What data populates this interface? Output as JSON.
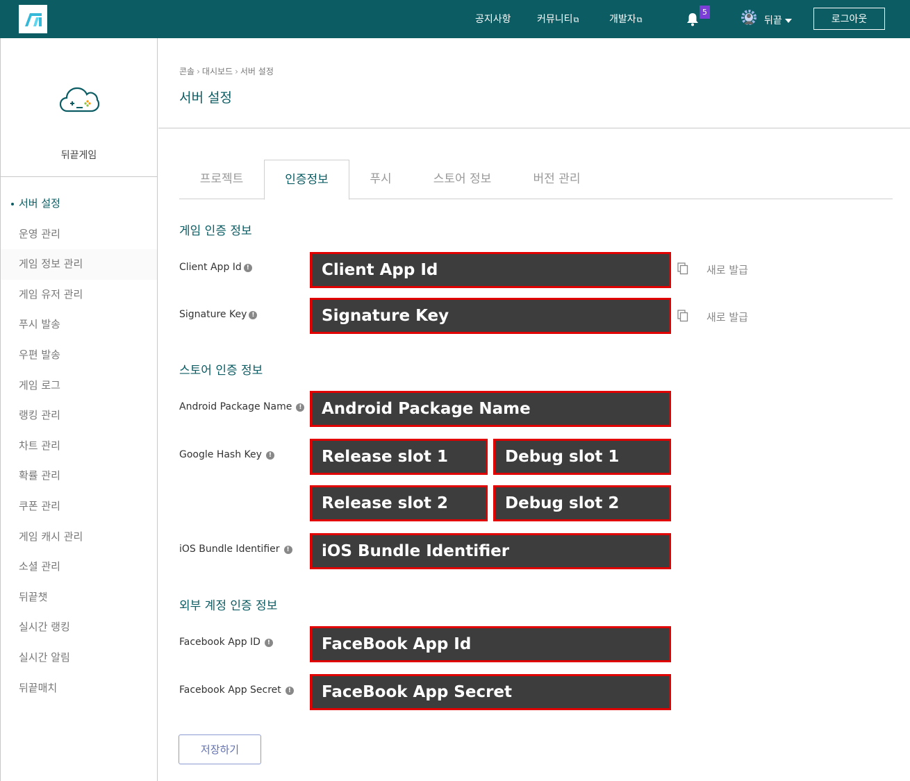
{
  "header": {
    "nav": [
      "공지사항",
      "커뮤니티",
      "개발자"
    ],
    "external_icon": "external-link-icon",
    "notification_count": "5",
    "user_name": "뒤끝",
    "logout_label": "로그아웃",
    "colors": {
      "header_bg": "#0b5c63",
      "badge_bg": "#7b3ed7"
    }
  },
  "sidebar": {
    "game_name": "뒤끝게임",
    "items": [
      {
        "label": "서버 설정",
        "active": true
      },
      {
        "label": "운영 관리"
      },
      {
        "label": "게임 정보 관리"
      },
      {
        "label": "게임 유저 관리"
      },
      {
        "label": "푸시 발송"
      },
      {
        "label": "우편 발송"
      },
      {
        "label": "게임 로그"
      },
      {
        "label": "랭킹 관리"
      },
      {
        "label": "차트 관리"
      },
      {
        "label": "확률 관리"
      },
      {
        "label": "쿠폰 관리"
      },
      {
        "label": "게임 캐시 관리"
      },
      {
        "label": "소셜 관리"
      },
      {
        "label": "뒤끝챗"
      },
      {
        "label": "실시간 랭킹"
      },
      {
        "label": "실시간 알림"
      },
      {
        "label": "뒤끝매치"
      }
    ]
  },
  "breadcrumb": [
    "콘솔",
    "대시보드",
    "서버 설정"
  ],
  "page_title": "서버 설정",
  "tabs": [
    {
      "label": "프로젝트"
    },
    {
      "label": "인증정보",
      "active": true
    },
    {
      "label": "푸시"
    },
    {
      "label": "스토어 정보"
    },
    {
      "label": "버전 관리"
    }
  ],
  "sections": {
    "game_auth": "게임 인증 정보",
    "store_auth": "스토어 인증 정보",
    "external_auth": "외부 계정 인증 정보"
  },
  "fields": {
    "client_app_id": {
      "label": "Client App Id",
      "value": "Client App Id"
    },
    "signature_key": {
      "label": "Signature Key",
      "value": "Signature Key"
    },
    "android_package": {
      "label": "Android Package Name",
      "value": "Android Package Name"
    },
    "google_hash": {
      "label": "Google Hash Key",
      "release_1": "Release slot 1",
      "debug_1": "Debug slot 1",
      "release_2": "Release slot 2",
      "debug_2": "Debug slot 2"
    },
    "ios_bundle": {
      "label": "iOS Bundle Identifier",
      "value": "iOS Bundle Identifier"
    },
    "facebook_app_id": {
      "label": "Facebook App ID",
      "value": "FaceBook App Id"
    },
    "facebook_app_secret": {
      "label": "Facebook App Secret",
      "value": "FaceBook App Secret"
    }
  },
  "reissue_label": "새로 발급",
  "info_glyph": "!",
  "save_label": "저장하기"
}
